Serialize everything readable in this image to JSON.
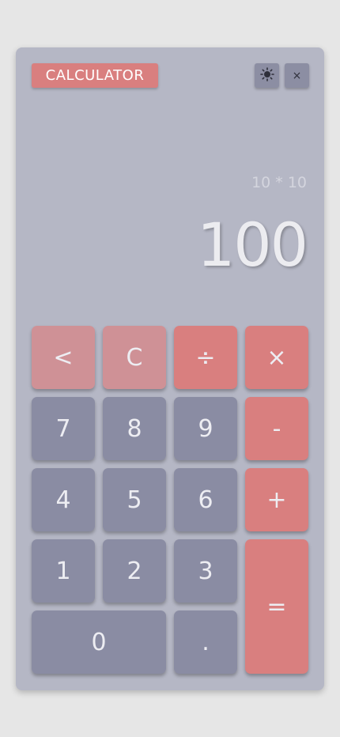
{
  "app": {
    "title": "CALCULATOR"
  },
  "toolbar": {
    "theme_icon": "sun-icon",
    "close_label": "×"
  },
  "display": {
    "expression": "10 * 10",
    "result": "100"
  },
  "keypad": {
    "backspace": "<",
    "clear": "C",
    "divide": "÷",
    "multiply": "×",
    "seven": "7",
    "eight": "8",
    "nine": "9",
    "subtract": "-",
    "four": "4",
    "five": "5",
    "six": "6",
    "add": "+",
    "one": "1",
    "two": "2",
    "three": "3",
    "equals": "=",
    "zero": "0",
    "decimal": "."
  },
  "colors": {
    "panel": "#b5b7c5",
    "number_key": "#8a8ca3",
    "function_key": "#cf9196",
    "operator_key": "#d97f7f",
    "accent": "#d97f7f"
  }
}
